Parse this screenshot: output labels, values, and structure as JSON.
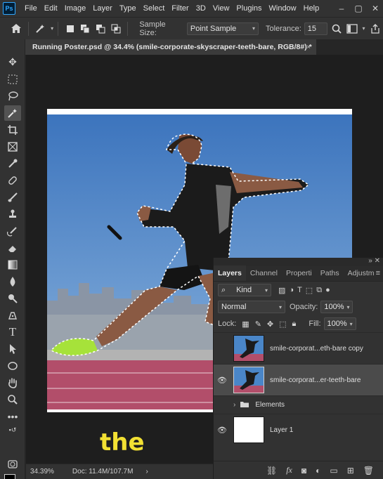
{
  "app": {
    "logo": "Ps"
  },
  "menu": [
    "File",
    "Edit",
    "Image",
    "Layer",
    "Type",
    "Select",
    "Filter",
    "3D",
    "View",
    "Plugins",
    "Window",
    "Help"
  ],
  "window_controls": [
    "minimize-icon",
    "maximize-icon",
    "close-icon"
  ],
  "options": {
    "sample_size_label": "Sample Size:",
    "sample_size_value": "Point Sample",
    "tolerance_label": "Tolerance:",
    "tolerance_value": "15"
  },
  "document": {
    "tab_title": "Running Poster.psd @ 34.4% (smile-corporate-skyscraper-teeth-bare, RGB/8#) *",
    "close": "×",
    "caption": "the"
  },
  "status": {
    "zoom": "34.39%",
    "doc": "Doc: 11.4M/107.7M",
    "arrow": "›"
  },
  "layers_panel": {
    "tabs": [
      "Layers",
      "Channel",
      "Properti",
      "Paths",
      "Adjustm"
    ],
    "filter_kind": "Kind",
    "blend_mode": "Normal",
    "opacity_label": "Opacity:",
    "opacity_value": "100%",
    "lock_label": "Lock:",
    "fill_label": "Fill:",
    "fill_value": "100%",
    "layers": [
      {
        "name": "smile-corporat...eth-bare copy",
        "visible": false,
        "selected": false
      },
      {
        "name": "smile-corporat...er-teeth-bare",
        "visible": true,
        "selected": true
      },
      {
        "name": "Elements",
        "visible": false,
        "selected": false,
        "group": true
      },
      {
        "name": "Layer 1",
        "visible": true,
        "selected": false
      }
    ]
  },
  "colors": {
    "caption": "#f2e033",
    "sky": "#4a86c8",
    "track": "#b24e6a",
    "shoe": "#a6e23a"
  }
}
